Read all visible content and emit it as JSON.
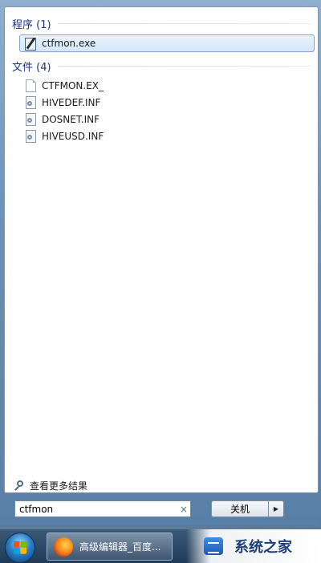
{
  "programs": {
    "header": "程序 (1)",
    "items": [
      {
        "label": "ctfmon.exe",
        "icon": "notepad-icon",
        "selected": true
      }
    ]
  },
  "files": {
    "header": "文件 (4)",
    "items": [
      {
        "label": "CTFMON.EX_",
        "icon": "blank-file-icon"
      },
      {
        "label": "HIVEDEF.INF",
        "icon": "inf-file-icon"
      },
      {
        "label": "DOSNET.INF",
        "icon": "inf-file-icon"
      },
      {
        "label": "HIVEUSD.INF",
        "icon": "inf-file-icon"
      }
    ]
  },
  "see_more": "查看更多结果",
  "search": {
    "value": "ctfmon",
    "clear_glyph": "×"
  },
  "shutdown": {
    "label": "关机",
    "arrow_glyph": "▶"
  },
  "taskbar": {
    "start_orb": "windows-start-icon",
    "active_task": {
      "label": "高级编辑器_百度...",
      "icon": "firefox-icon"
    }
  },
  "watermark": {
    "text": "系统之家"
  },
  "colors": {
    "header_text": "#1e3287",
    "selected_bg": "#d3e7fa",
    "selected_border": "#7da2ce"
  }
}
